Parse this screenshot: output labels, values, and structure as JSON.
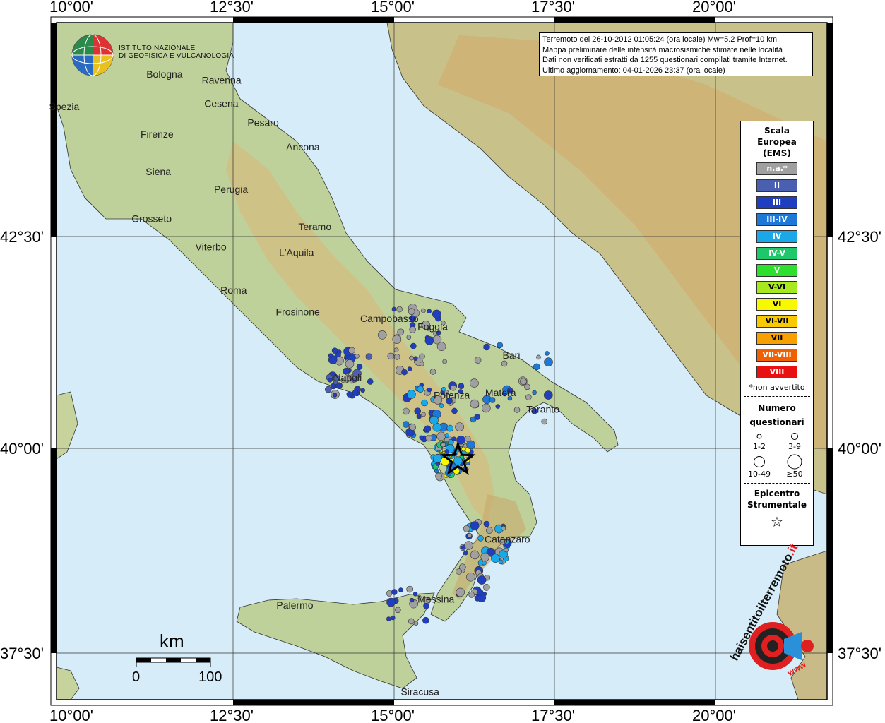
{
  "map": {
    "lon_labels": [
      "10°00'",
      "12°30'",
      "15°00'",
      "17°30'",
      "20°00'"
    ],
    "lat_labels": [
      "42°30'",
      "40°00'",
      "37°30'"
    ],
    "cities": [
      {
        "name": "Bologna",
        "lon": 11.34,
        "lat": 44.49
      },
      {
        "name": "Ravenna",
        "lon": 12.2,
        "lat": 44.42
      },
      {
        "name": "Spezia",
        "lon": 9.83,
        "lat": 44.1
      },
      {
        "name": "Cesena",
        "lon": 12.24,
        "lat": 44.14
      },
      {
        "name": "Pesaro",
        "lon": 12.91,
        "lat": 43.91
      },
      {
        "name": "Firenze",
        "lon": 11.25,
        "lat": 43.77
      },
      {
        "name": "Ancona",
        "lon": 13.51,
        "lat": 43.62
      },
      {
        "name": "Siena",
        "lon": 11.33,
        "lat": 43.32
      },
      {
        "name": "Perugia",
        "lon": 12.39,
        "lat": 43.11
      },
      {
        "name": "Grosseto",
        "lon": 11.11,
        "lat": 42.76
      },
      {
        "name": "Teramo",
        "lon": 13.7,
        "lat": 42.66
      },
      {
        "name": "Viterbo",
        "lon": 12.1,
        "lat": 42.42
      },
      {
        "name": "L'Aquila",
        "lon": 13.4,
        "lat": 42.35
      },
      {
        "name": "Roma",
        "lon": 12.49,
        "lat": 41.9
      },
      {
        "name": "Frosinone",
        "lon": 13.35,
        "lat": 41.64
      },
      {
        "name": "Campobasso",
        "lon": 14.66,
        "lat": 41.56
      },
      {
        "name": "Foggia",
        "lon": 15.55,
        "lat": 41.46
      },
      {
        "name": "Bari",
        "lon": 16.87,
        "lat": 41.12
      },
      {
        "name": "Napoli",
        "lon": 14.25,
        "lat": 40.85
      },
      {
        "name": "Potenza",
        "lon": 15.8,
        "lat": 40.64
      },
      {
        "name": "Matera",
        "lon": 16.6,
        "lat": 40.67
      },
      {
        "name": "Taranto",
        "lon": 17.24,
        "lat": 40.47
      },
      {
        "name": "Catanzaro",
        "lon": 16.59,
        "lat": 38.91
      },
      {
        "name": "Palermo",
        "lon": 13.36,
        "lat": 38.12
      },
      {
        "name": "Messina",
        "lon": 15.55,
        "lat": 38.19
      },
      {
        "name": "Siracusa",
        "lon": 15.29,
        "lat": 37.08
      }
    ],
    "epicenter": {
      "lon": 15.98,
      "lat": 39.86
    }
  },
  "logo": {
    "line1": "ISTITUTO NAZIONALE",
    "line2": "DI GEOFISICA E VULCANOLOGIA"
  },
  "info": {
    "line1": "Terremoto del 26-10-2012 01:05:24 (ora locale) Mw=5.2 Prof=10 km",
    "line2": "Mappa preliminare delle intensità macrosismiche stimate nelle località",
    "line3": "Dati non verificati estratti da 1255 questionari compilati tramite Internet.",
    "line4": "Ultimo aggiornamento: 04-01-2026 23:37 (ora locale)"
  },
  "legend": {
    "title1": "Scala",
    "title2": "Europea",
    "title3": "(EMS)",
    "items": [
      {
        "label": "n.a.*",
        "color": "#a0a0a0"
      },
      {
        "label": "II",
        "color": "#4a5fb0"
      },
      {
        "label": "III",
        "color": "#1f3fc0"
      },
      {
        "label": "III-IV",
        "color": "#1e78d8"
      },
      {
        "label": "IV",
        "color": "#1aa8e8"
      },
      {
        "label": "IV-V",
        "color": "#1ec86a"
      },
      {
        "label": "V",
        "color": "#2ee02e"
      },
      {
        "label": "V-VI",
        "color": "#a8e81e"
      },
      {
        "label": "VI",
        "color": "#f8f800"
      },
      {
        "label": "VI-VII",
        "color": "#f8c800"
      },
      {
        "label": "VII",
        "color": "#f8a000"
      },
      {
        "label": "VII-VIII",
        "color": "#f06000"
      },
      {
        "label": "VIII",
        "color": "#e81010"
      }
    ],
    "note": "*non avvertito",
    "questionnaire_title1": "Numero",
    "questionnaire_title2": "questionari",
    "sizes": [
      "1-2",
      "3-9",
      "10-49",
      "≥50"
    ],
    "epicenter_title1": "Epicentro",
    "epicenter_title2": "Strumentale"
  },
  "scale_bar": {
    "unit": "km",
    "start": "0",
    "end": "100"
  },
  "watermark": {
    "text1": "haisentitoilterremoto",
    "text2": ".it",
    "text3": "www"
  }
}
